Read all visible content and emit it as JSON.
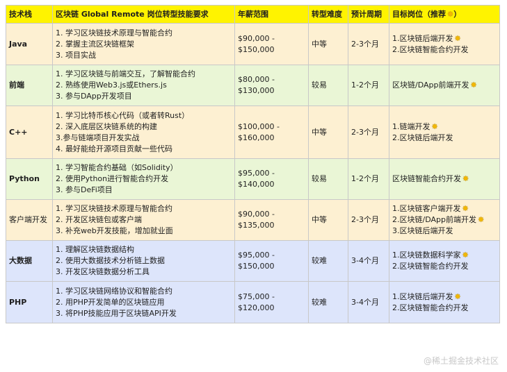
{
  "headers": {
    "tech": "技术栈",
    "requirements": "区块链 Global Remote 岗位转型技能要求",
    "salary": "年薪范围",
    "difficulty": "转型难度",
    "period": "预计周期",
    "target": "目标岗位（推荐",
    "target_close": "）"
  },
  "rows": [
    {
      "tech": "Java",
      "requirements": [
        "1. 学习区块链技术原理与智能合约",
        "2. 掌握主流区块链框架",
        "3. 项目实战"
      ],
      "salary": [
        "$90,000 -",
        "$150,000"
      ],
      "difficulty": "中等",
      "period": "2-3个月",
      "positions": [
        "1.区块链后端开发",
        "2.区块链智能合约开发"
      ]
    },
    {
      "tech": "前端",
      "requirements": [
        "1. 学习区块链与前端交互，了解智能合约",
        "2. 熟练使用Web3.js或Ethers.js",
        "3. 参与DApp开发项目"
      ],
      "salary": [
        "$80,000 -",
        "$130,000"
      ],
      "difficulty": "较易",
      "period": "1-2个月",
      "positions": [
        "区块链/DApp前端开发"
      ]
    },
    {
      "tech": "C++",
      "requirements": [
        "1. 学习比特币核心代码（或者转Rust）",
        "2. 深入底层区块链系统的构建",
        "3.参与链端项目开发实战",
        "4. 最好能给开源项目贡献一些代码"
      ],
      "salary": [
        "$100,000 -",
        "$160,000"
      ],
      "difficulty": "中等",
      "period": "2-3个月",
      "positions": [
        "1.链端开发",
        "2.区块链后端开发"
      ]
    },
    {
      "tech": "Python",
      "requirements": [
        "1. 学习智能合约基础（如Solidity）",
        "2. 使用Python进行智能合约开发",
        "3. 参与DeFi项目"
      ],
      "salary": [
        "$95,000 -",
        "$140,000"
      ],
      "difficulty": "较易",
      "period": "1-2个月",
      "positions": [
        "区块链智能合约开发"
      ]
    },
    {
      "tech": "客户端开发",
      "requirements": [
        "1. 学习区块链技术原理与智能合约",
        "2. 开发区块链包或客户端",
        "3. 补充web开发技能，增加就业面"
      ],
      "salary": [
        "$90,000 -",
        "$135,000"
      ],
      "difficulty": "中等",
      "period": "2-3个月",
      "positions": [
        "1.区块链客户端开发",
        "2.区块链/DApp前端开发",
        "3.区块链后端开发"
      ]
    },
    {
      "tech": "大数据",
      "requirements": [
        "1. 理解区块链数据结构",
        "2. 使用大数据技术分析链上数据",
        "3. 开发区块链数据分析工具"
      ],
      "salary": [
        "$95,000 -",
        "$150,000"
      ],
      "difficulty": "较难",
      "period": "3-4个月",
      "positions": [
        "1.区块链数据科学家",
        "2.区块链智能合约开发"
      ]
    },
    {
      "tech": "PHP",
      "requirements": [
        "1. 学习区块链网络协议和智能合约",
        "2. 用PHP开发简单的区块链应用",
        "3. 将PHP技能应用于区块链API开发"
      ],
      "salary": [
        "$75,000 -",
        "$120,000"
      ],
      "difficulty": "较难",
      "period": "3-4个月",
      "positions": [
        "1.区块链后端开发",
        "2.区块链智能合约开发"
      ]
    }
  ],
  "recommend_icon": "sparkle-icon",
  "watermark": "@稀土掘金技术社区"
}
